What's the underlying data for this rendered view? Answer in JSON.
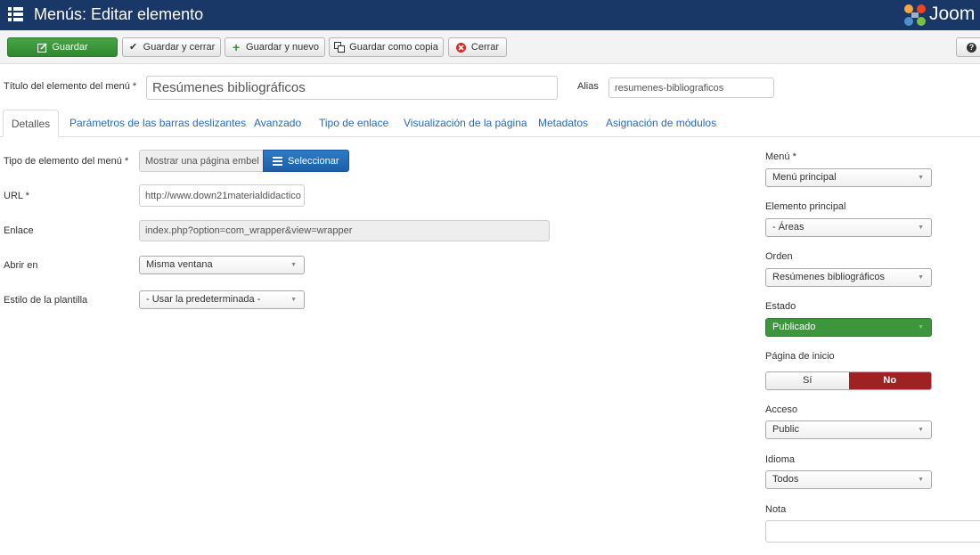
{
  "header": {
    "title": "Menús: Editar elemento",
    "brand_text": "Joom"
  },
  "toolbar": {
    "save_label": "Guardar",
    "save_close_label": "Guardar y cerrar",
    "save_new_label": "Guardar y nuevo",
    "save_copy_label": "Guardar como copia",
    "close_label": "Cerrar"
  },
  "title_row": {
    "title_label": "Título del elemento del menú *",
    "title_value": "Resúmenes bibliográficos",
    "alias_label": "Alias",
    "alias_value": "resumenes-bibliograficos"
  },
  "tabs": [
    {
      "label": "Detalles"
    },
    {
      "label": "Parámetros de las barras deslizantes"
    },
    {
      "label": "Avanzado"
    },
    {
      "label": "Tipo de enlace"
    },
    {
      "label": "Visualización de la página"
    },
    {
      "label": "Metadatos"
    },
    {
      "label": "Asignación de módulos"
    }
  ],
  "details": {
    "type_label": "Tipo de elemento del menú *",
    "type_value": "Mostrar una página embel",
    "select_button": "Seleccionar",
    "url_label": "URL *",
    "url_value": "http://www.down21materialdidactico",
    "link_label": "Enlace",
    "link_value": "index.php?option=com_wrapper&view=wrapper",
    "open_in_label": "Abrir en",
    "open_in_value": "Misma ventana",
    "template_style_label": "Estilo de la plantilla",
    "template_style_value": "- Usar la predeterminada -"
  },
  "sidebar": {
    "menu_label": "Menú *",
    "menu_value": "Menú principal",
    "parent_label": "Elemento principal",
    "parent_value": "- Áreas",
    "order_label": "Orden",
    "order_value": "Resúmenes bibliográficos",
    "status_label": "Estado",
    "status_value": "Publicado",
    "home_label": "Página de inicio",
    "home_yes": "Sí",
    "home_no": "No",
    "access_label": "Acceso",
    "access_value": "Public",
    "language_label": "Idioma",
    "language_value": "Todos",
    "note_label": "Nota",
    "note_value": ""
  },
  "colors": {
    "header_bg": "#1a3867",
    "save_green": "#3d963d",
    "select_blue": "#2a69b8",
    "no_red": "#9e2222"
  }
}
